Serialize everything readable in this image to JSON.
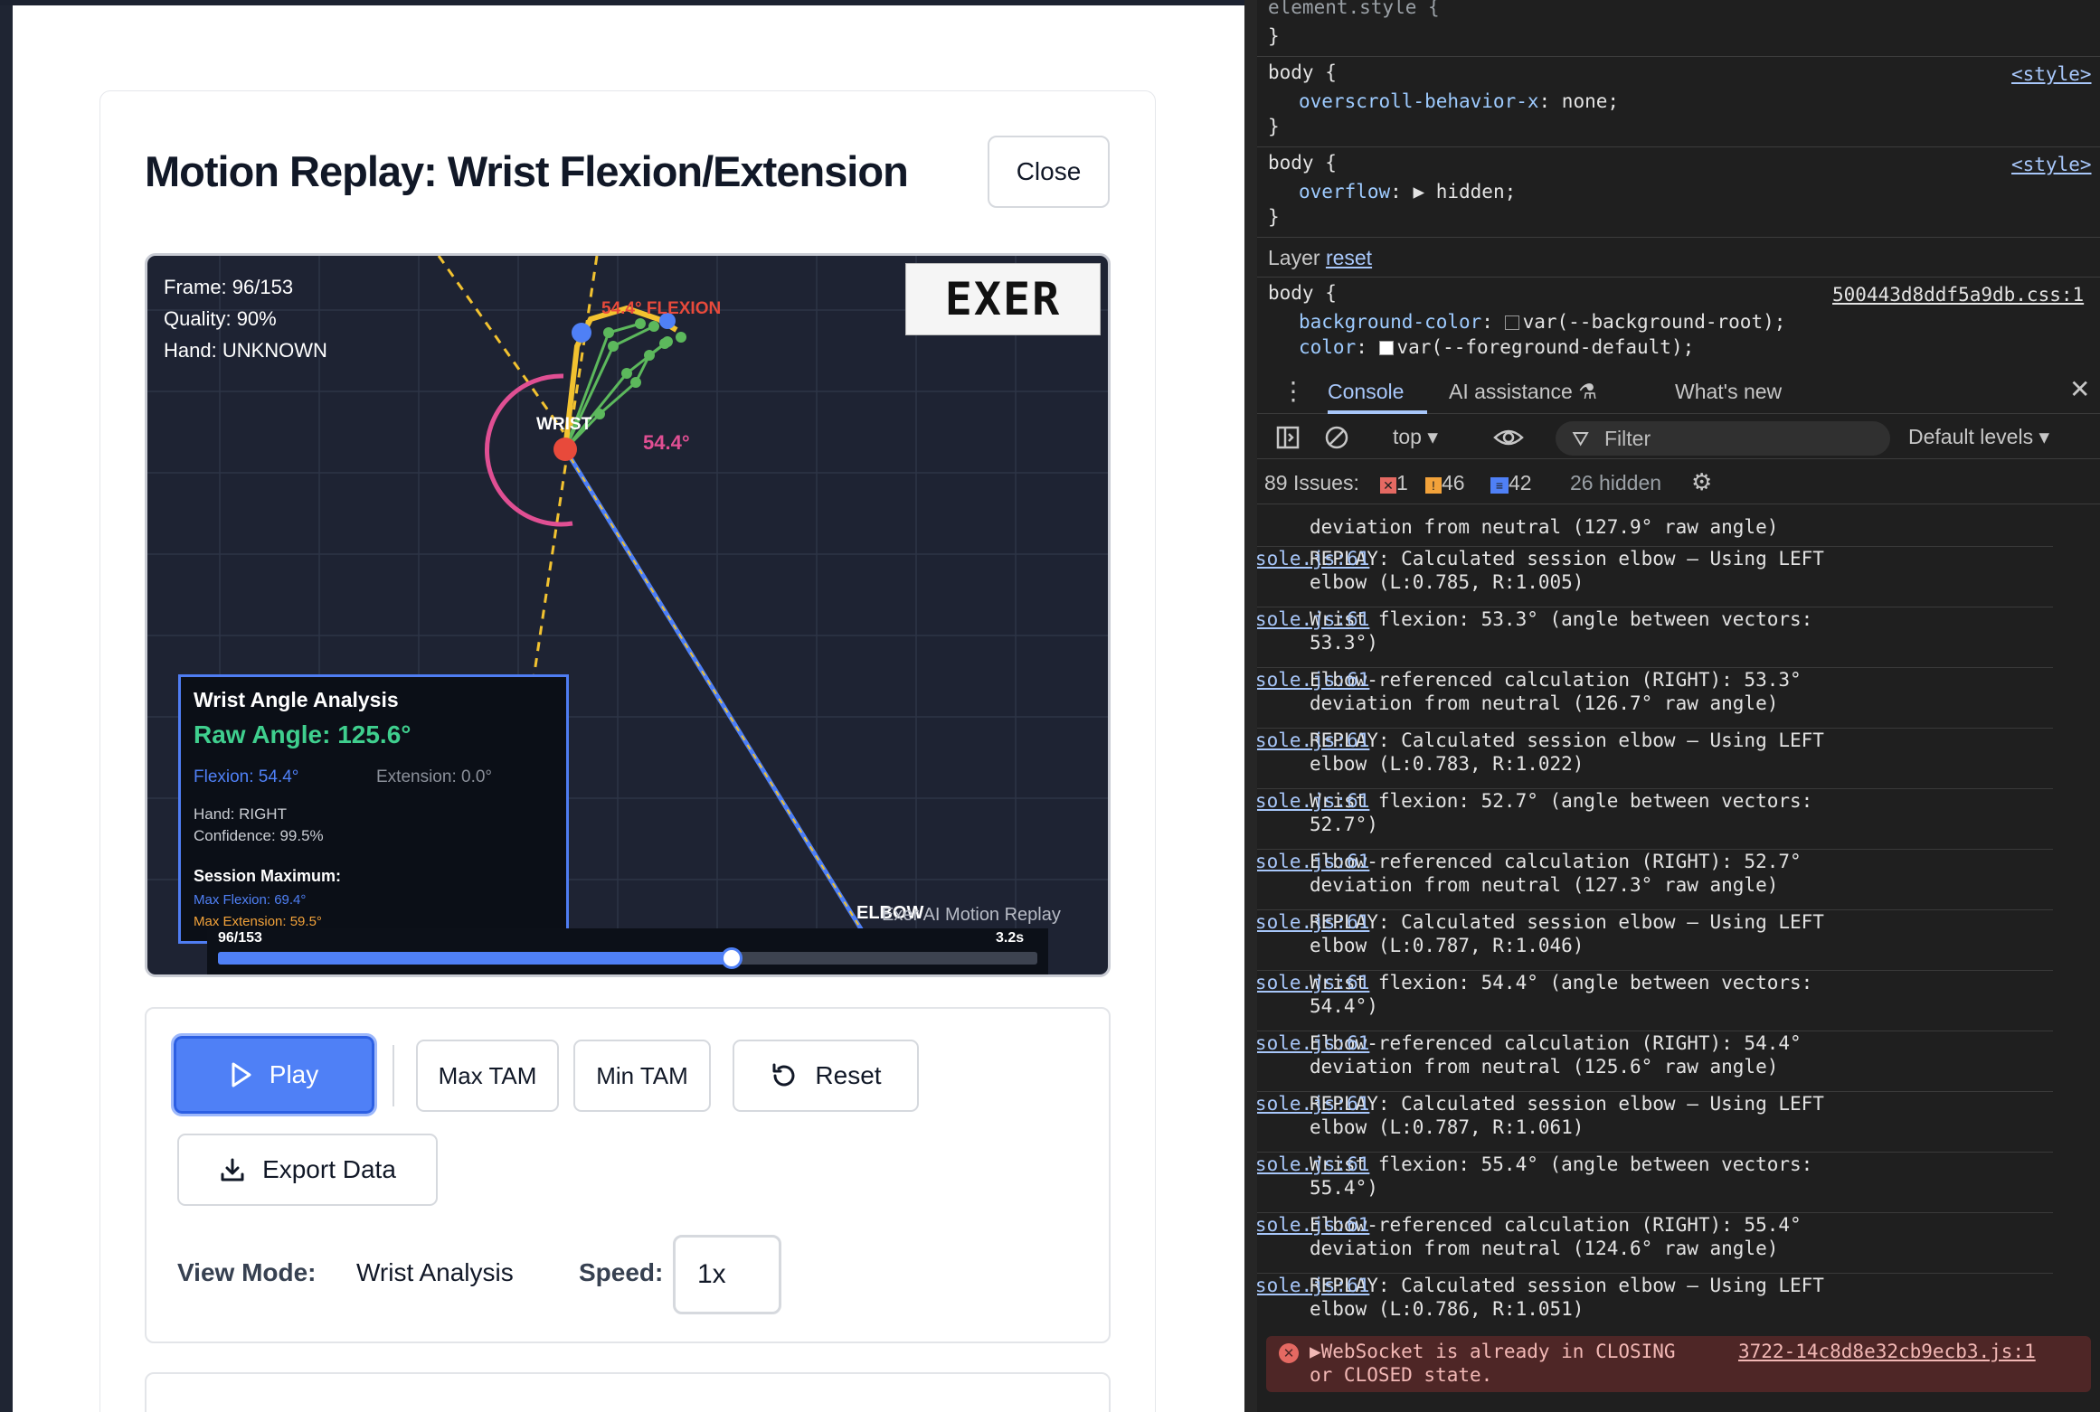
{
  "modal": {
    "title": "Motion Replay: Wrist Flexion/Extension",
    "close_label": "Close"
  },
  "replay": {
    "frame_text": "Frame: 96/153",
    "quality_text": "Quality: 90%",
    "hand_text": "Hand: UNKNOWN",
    "logo_text": "EXER",
    "wrist_label": "WRIST",
    "elbow_label": "ELBOW",
    "flexion_tag": "54.4° FLEXION",
    "angle_tag": "54.4°",
    "watermark": "Exer AI Motion Replay",
    "analysis": {
      "title": "Wrist Angle Analysis",
      "raw_angle": "Raw Angle: 125.6°",
      "flexion": "Flexion: 54.4°",
      "extension": "Extension: 0.0°",
      "hand": "Hand: RIGHT",
      "confidence": "Confidence: 99.5%",
      "session_max_title": "Session Maximum:",
      "max_flexion": "Max Flexion: 69.4°",
      "max_extension": "Max Extension: 59.5°"
    },
    "scrubber": {
      "frame_label": "96/153",
      "time_label": "3.2s",
      "progress": 0.627
    }
  },
  "controls": {
    "play_label": "Play",
    "max_tam_label": "Max TAM",
    "min_tam_label": "Min TAM",
    "reset_label": "Reset",
    "export_label": "Export Data",
    "view_mode_label": "View Mode:",
    "view_mode_value": "Wrist Analysis",
    "speed_label": "Speed:",
    "speed_value": "1x"
  },
  "devtools": {
    "styles": {
      "element_style": "element.style {",
      "close_brace": "}",
      "rule1_selector": "body {",
      "rule1_prop": "overscroll-behavior-x",
      "rule1_value": ": none;",
      "rule1_source": "<style>",
      "rule2_selector": "body {",
      "rule2_prop": "overflow",
      "rule2_value": ": ▶ hidden;",
      "rule2_source": "<style>",
      "layer_label": "Layer",
      "layer_link": "reset",
      "rule3_selector": "body {",
      "rule3_source": "500443d8ddf5a9db.css:1",
      "rule3_prop1": "background-color",
      "rule3_value1": "var(--background-root);",
      "rule3_prop2": "color",
      "rule3_value2": "var(--foreground-default);"
    },
    "tabs": [
      "Console",
      "AI assistance",
      "What's new"
    ],
    "toolbar": {
      "context": "top",
      "filter_placeholder": "Filter",
      "levels": "Default levels"
    },
    "issues": {
      "label": "89 Issues:",
      "errors": "1",
      "warnings": "46",
      "info": "42",
      "hidden": "26 hidden"
    },
    "logs": [
      {
        "text": "deviation from neutral (127.9° raw angle)",
        "source": ""
      },
      {
        "text": "REPLAY: Calculated session elbow – Using LEFT\nelbow (L:0.785, R:1.005)",
        "source": "Console.js:61"
      },
      {
        "text": "Wrist flexion: 53.3° (angle between vectors:\n53.3°)",
        "source": "Console.js:61"
      },
      {
        "text": "Elbow-referenced calculation (RIGHT): 53.3°\ndeviation from neutral (126.7° raw angle)",
        "source": "Console.js:61"
      },
      {
        "text": "REPLAY: Calculated session elbow – Using LEFT\nelbow (L:0.783, R:1.022)",
        "source": "Console.js:61"
      },
      {
        "text": "Wrist flexion: 52.7° (angle between vectors:\n52.7°)",
        "source": "Console.js:61"
      },
      {
        "text": "Elbow-referenced calculation (RIGHT): 52.7°\ndeviation from neutral (127.3° raw angle)",
        "source": "Console.js:61"
      },
      {
        "text": "REPLAY: Calculated session elbow – Using LEFT\nelbow (L:0.787, R:1.046)",
        "source": "Console.js:61"
      },
      {
        "text": "Wrist flexion: 54.4° (angle between vectors:\n54.4°)",
        "source": "Console.js:61"
      },
      {
        "text": "Elbow-referenced calculation (RIGHT): 54.4°\ndeviation from neutral (125.6° raw angle)",
        "source": "Console.js:61"
      },
      {
        "text": "REPLAY: Calculated session elbow – Using LEFT\nelbow (L:0.787, R:1.061)",
        "source": "Console.js:61"
      },
      {
        "text": "Wrist flexion: 55.4° (angle between vectors:\n55.4°)",
        "source": "Console.js:61"
      },
      {
        "text": "Elbow-referenced calculation (RIGHT): 55.4°\ndeviation from neutral (124.6° raw angle)",
        "source": "Console.js:61"
      },
      {
        "text": "REPLAY: Calculated session elbow – Using LEFT\nelbow (L:0.786, R:1.051)",
        "source": "Console.js:61"
      }
    ],
    "error": {
      "text": "▶WebSocket is already in CLOSING\nor CLOSED state.",
      "source": "3722-14c8d8e32cb9ecb3.js:1"
    }
  }
}
